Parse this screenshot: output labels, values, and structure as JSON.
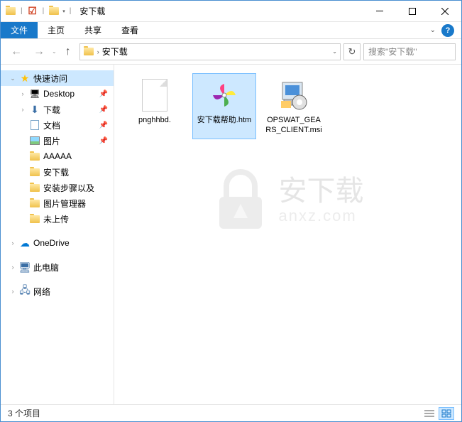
{
  "titlebar": {
    "title": "安下载"
  },
  "ribbon": {
    "file": "文件",
    "home": "主页",
    "share": "共享",
    "view": "查看"
  },
  "addressbar": {
    "crumb": "安下载",
    "search_placeholder": "搜索\"安下载\""
  },
  "sidebar": {
    "quick_access": "快速访问",
    "desktop": "Desktop",
    "downloads": "下载",
    "documents": "文档",
    "pictures": "图片",
    "aaaaa": "AAAAA",
    "anxiazai": "安下载",
    "install_steps": "安装步骤以及",
    "pic_manager": "图片管理器",
    "not_uploaded": "未上传",
    "onedrive": "OneDrive",
    "this_pc": "此电脑",
    "network": "网络"
  },
  "files": [
    {
      "name": "pnghhbd.",
      "type": "blank",
      "selected": false
    },
    {
      "name": "安下载帮助.htm",
      "type": "htm",
      "selected": true
    },
    {
      "name": "OPSWAT_GEARS_CLIENT.msi",
      "type": "msi",
      "selected": false
    }
  ],
  "statusbar": {
    "count": "3 个项目"
  },
  "watermark": {
    "text": "安下载",
    "sub": "anxz.com"
  }
}
